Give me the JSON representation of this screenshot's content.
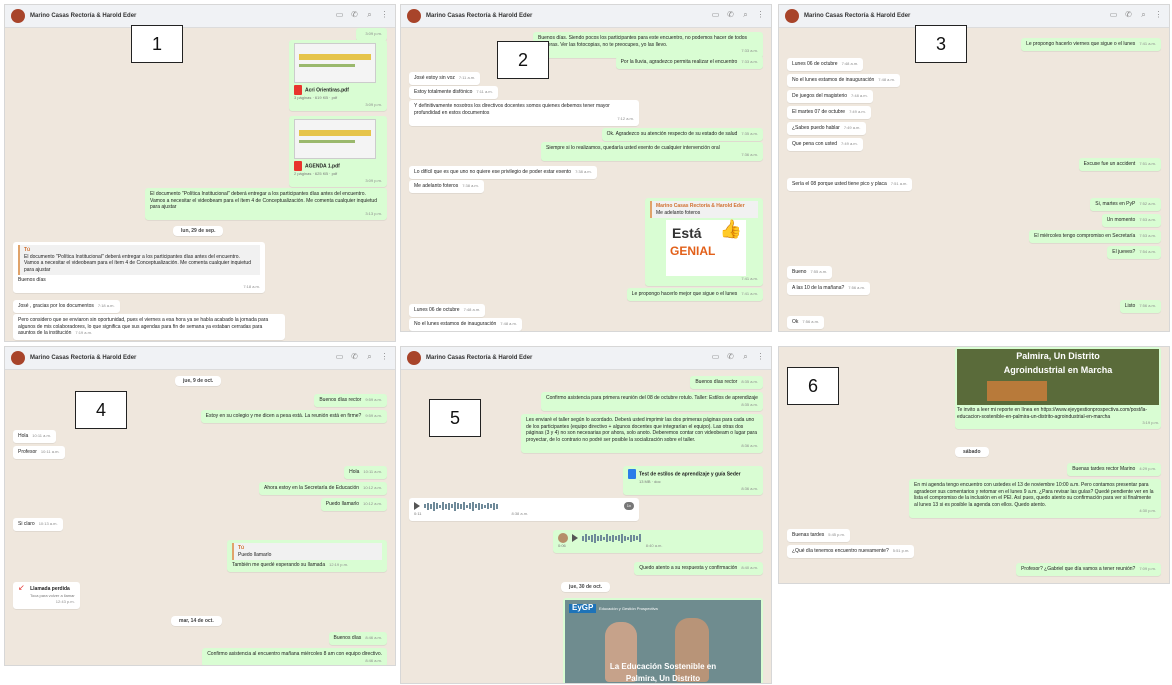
{
  "contact_name": "Marino Casas Rectoría & Harold Eder",
  "panel_numbers": [
    "1",
    "2",
    "3",
    "4",
    "5",
    "6"
  ],
  "colors": {
    "chat_bg": "#efe7dd",
    "outgoing": "#d9fdd3",
    "incoming": "#ffffff",
    "header": "#f0f2f5"
  },
  "p1": {
    "t0": "3:09 p.m.",
    "file1": "Acri Orientiras.pdf",
    "file1_meta": "3 páginas · 619 KB · pdf",
    "file1_ts": "3:09 p.m.",
    "file2": "AGENDA 1.pdf",
    "file2_meta": "2 páginas · 625 KB · pdf",
    "file2_ts": "3:09 p.m.",
    "msg1": "El documento \"Política Institucional\" deberá entregar a los participantes días antes del encuentro. Vamos a necesitar el videobeam para el ítem 4 de Conceptualización. Me comenta cualquier inquietud para ajustar",
    "msg1_ts": "3:13 p.m.",
    "day1": "lun, 29 de sep.",
    "quote_name": "Tú",
    "quote_text": "El documento \"Política Institucional\" deberá entregar a los participantes días antes del encuentro. Vamos a necesitar el videobeam para el ítem 4 de Conceptualización. Me comenta cualquier inquietud para ajustar",
    "reply1": "Buenos días",
    "reply1_ts": "7:18 a.m.",
    "msg2": "José , gracias por los documentos",
    "msg2_ts": "7:18 a.m.",
    "msg3": "Pero considero que se enviaron sin oportunidad, pues el viernes a esa hora ya se había acabado la jornada para algunos de mis colaboradores, lo que significa que sus agendas para fin de semana ya estaban cerradas para asuntos de la institución",
    "msg3_ts": "7:19 a.m."
  },
  "p2": {
    "o1": "Buenos días. Siendo pocos los participantes para este encuentro, no podemos hacer de todos maneras. Ver las fotocopias, no te preocupes, yo las llevo.",
    "o1_ts": "7:33 a.m.",
    "o2": "Por la lluvia, agradezco permita realizar el encuentro",
    "o2_ts": "7:33 a.m.",
    "i1": "José estoy sin voz",
    "i1_ts": "7:11 a.m.",
    "i2": "Estoy totalmente disfónico",
    "i2_ts": "7:11 a.m.",
    "i3": "Y definitivamente nosotros los directivos docentes somos quienes debemos tener mayor profundidad en estos documentos",
    "i3_ts": "7:12 a.m.",
    "o3": "Ok. Agradezco su atención respecto de su estado de salud",
    "o3_ts": "7:35 a.m.",
    "o4": "Siempre si lo realizamos, quedaría usted exento de cualquier intervención oral",
    "o4_ts": "7:36 a.m.",
    "i4": "Lo difícil que es que uno no quiere ese privilegio de poder estar exento",
    "i4_ts": "7:38 a.m.",
    "i5": "Me adelanto foteros",
    "i5_ts": "7:38 a.m.",
    "fwd_name": "Marino Casas Rectoría & Harold Eder",
    "fwd_text": "Me adelanto foteros",
    "sticker_line1": "Está",
    "sticker_line2": "GENIAL",
    "sticker_ts": "7:41 a.m.",
    "o5": "Le propongo hacerlo mejor que sigue o el lunes",
    "o5_ts": "7:41 a.m.",
    "i6": "Lunes 06 de octubre",
    "i6_ts": "7:48 a.m.",
    "i7": "No el lunes estamos de inauguración",
    "i7_ts": "7:48 a.m."
  },
  "p3": {
    "o1": "Le propongo hacerlo viernes que sigue o el lunes",
    "o1_ts": "7:41 a.m.",
    "i1": "Lunes 06 de octubre",
    "i1_ts": "7:48 a.m.",
    "i2": "No el lunes estamos de inauguración",
    "i2_ts": "7:48 a.m.",
    "i3": "De juegos del magisterio",
    "i3_ts": "7:48 a.m.",
    "i4": "El martes 07 de octubre",
    "i4_ts": "7:49 a.m.",
    "i5": "¿Sabes puedo hablar",
    "i5_ts": "7:49 a.m.",
    "i6": "Que pena con usted",
    "i6_ts": "7:49 a.m.",
    "o2": "Excuse fue un accident",
    "o2_ts": "7:51 a.m.",
    "i7": "Sería el 08 porque usted tiene pico y placa",
    "i7_ts": "7:51 a.m.",
    "o3": "Si, martes en PyP",
    "o3_ts": "7:52 a.m.",
    "o4": "Un momento",
    "o4_ts": "7:53 a.m.",
    "o5": "El miércoles tengo compromiso en Secretaría",
    "o5_ts": "7:53 a.m.",
    "o6": "El jueves?",
    "o6_ts": "7:54 a.m.",
    "i8": "Bueno",
    "i8_ts": "7:55 a.m.",
    "i9": "A las 10 de la mañana?",
    "i9_ts": "7:56 a.m.",
    "o7": "Listo",
    "o7_ts": "7:56 a.m.",
    "i10": "Ok",
    "i10_ts": "7:56 a.m."
  },
  "p4": {
    "day1": "jue, 9 de oct.",
    "o1": "Buenos días rector",
    "o1_ts": "9:59 a.m.",
    "o2": "Estoy en su colegio y me dicen a pesa está. La reunión está en firme?",
    "o2_ts": "9:59 a.m.",
    "i1": "Hola",
    "i1_ts": "10:11 a.m.",
    "i2": "Profesor",
    "i2_ts": "10:11 a.m.",
    "o3": "Hola",
    "o3_ts": "10:11 a.m.",
    "o4": "Ahora estoy en la Secretaría de Educación",
    "o4_ts": "10:12 a.m.",
    "o5": "Puedo llamarlo",
    "o5_ts": "10:12 a.m.",
    "i3": "Si claro",
    "i3_ts": "10:13 a.m.",
    "quote_name": "Tú",
    "quote_text": "Puedo llamarlo",
    "o6": "También me quedé esperando su llamada",
    "o6_ts": "12:19 p.m.",
    "missed_call": "Llamada perdida",
    "missed_call_sub": "Toca para volver a llamar",
    "missed_ts": "12:43 p.m.",
    "day2": "mar, 14 de oct.",
    "o7": "Buenos días",
    "o7_ts": "8:46 a.m.",
    "o8": "Confirmo asistencia al encuentro mañana miércoles 8 am con equipo directivo.",
    "o8_ts": "8:46 a.m."
  },
  "p5": {
    "o1": "Buenos días rector",
    "o1_ts": "8:35 a.m.",
    "o2": "Confirmo asistencia para primera reunión del 08 de octubre rotulo. Taller: Estilos de aprendizaje",
    "o2_ts": "8:35 a.m.",
    "o3": "Les enviaré el taller según lo acordado. Deberá usted imprimir las dos primeras páginas para cada uno de los participantes (equipo directivo + algunos docentes que integrarían el equipo). Las otras dos páginas (3 y 4) no son necesarias por ahora, solo anoto. Deberemos contar con videobeam o lugar para proyectar, de lo contrario no podré ser posible la socialización sobre el taller.",
    "o3_ts": "8:36 a.m.",
    "file": "Test de estilos de aprendizaje y guía Seder",
    "file_meta": "13 MB · doc",
    "file_ts": "8:36 a.m.",
    "audio1_dur": "0:11",
    "audio1_ts": "8:38 a.m.",
    "audio2_dur": "0:06",
    "audio2_ts": "8:40 a.m.",
    "o4": "Quedo atento a su respuesta y confirmación",
    "o4_ts": "8:40 a.m.",
    "day": "jue, 30 de oct.",
    "banner_brand": "EyGP",
    "banner_tag": "Educación y Gestión Prospectiva",
    "banner_text1": "La Educación Sostenible en",
    "banner_text2": "Palmira, Un Distrito"
  },
  "p6": {
    "banner1": "Palmira, Un Distrito",
    "banner2": "Agroindustrial en Marcha",
    "o1": "Te invito a leer mi reporte en línea en https://www.ejeygestionprospectiva.com/post/la-educacion-sostenible-en-palmira-un-distrito-agroindustrial-en-marcha",
    "o1_ts": "3:19 p.m.",
    "day": "sábado",
    "o2": "Buenas tardes rector Marino",
    "o2_ts": "4:29 p.m.",
    "o3": "En mi agenda tengo encuentro con ustedes el 13 de noviembre 10:00 a.m. Pero contamos presentar para agradecer sus comentarios y retomar en el lunes 9 a.m. ¿Para revisar las guías? Quedé pendiente ver en la lista el compromiso de la inclusión en el PEI. Así pues, quedo atento su confirmación para ver si finalmente al lunes 13 si es posible la agenda con ellos. Quedo atento.",
    "o3_ts": "4:30 p.m.",
    "i1": "Buenas tardes",
    "i1_ts": "5:45 p.m.",
    "i2": "¿Qué día tenemos encuentro nuevamente?",
    "i2_ts": "5:51 p.m.",
    "o4": "Profesor? ¿Gabriel que día vamos a tener reunión?",
    "o4_ts": "7:09 p.m."
  }
}
